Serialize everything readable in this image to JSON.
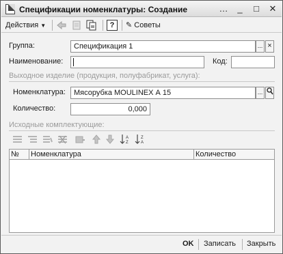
{
  "window": {
    "title": "Спецификации номенклатуры: Создание",
    "controls": [
      "...",
      "_",
      "□",
      "×"
    ]
  },
  "toolbar": {
    "actions_label": "Действия",
    "tips_label": "Советы",
    "help_glyph": "?"
  },
  "form": {
    "group_label": "Группа:",
    "group_value": "Спецификация 1",
    "name_label": "Наименование:",
    "name_value": "",
    "code_label": "Код:",
    "code_value": "",
    "output_section": "Выходное изделие (продукция, полуфабрикат, услуга):",
    "nomenclature_label": "Номенклатура:",
    "nomenclature_value": "Мясорубка MOULINEX  А 15",
    "quantity_label": "Количество:",
    "quantity_value": "0,000",
    "components_section": "Исходные комплектующие:"
  },
  "table": {
    "columns": [
      "№",
      "Номенклатура",
      "Количество"
    ],
    "rows": []
  },
  "footer": {
    "ok_label": "OK",
    "save_label": "Записать",
    "close_label": "Закрыть"
  },
  "icons": {
    "select": "...",
    "clear": "×",
    "search": "🔍"
  }
}
